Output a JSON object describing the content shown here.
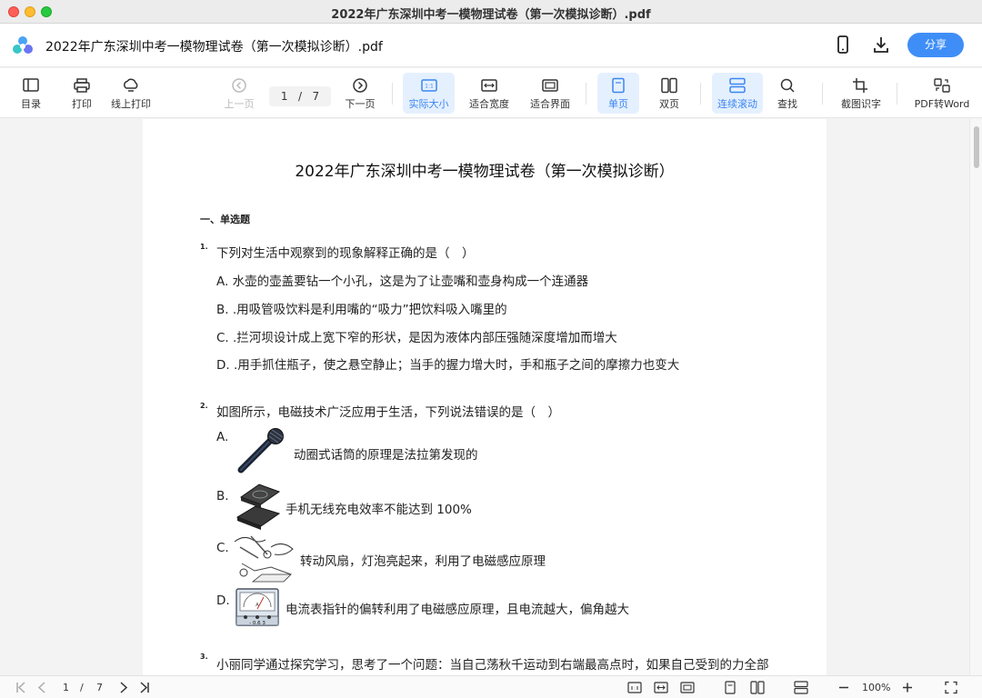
{
  "window": {
    "title": "2022年广东深圳中考一模物理试卷（第一次模拟诊断）.pdf"
  },
  "header": {
    "doc_title": "2022年广东深圳中考一模物理试卷（第一次模拟诊断）.pdf",
    "share_label": "分享"
  },
  "toolbar": {
    "toc": "目录",
    "print": "打印",
    "online_print": "线上打印",
    "prev": "上一页",
    "page_current": "1",
    "page_sep": "/",
    "page_total": "7",
    "next": "下一页",
    "actual_size": "实际大小",
    "fit_width": "适合宽度",
    "fit_screen": "适合界面",
    "single_page": "单页",
    "double_page": "双页",
    "continuous": "连续滚动",
    "find": "查找",
    "ocr": "截图识字",
    "pdf_to_word": "PDF转Word",
    "actual_size_icon_text": "1:1"
  },
  "document": {
    "title": "2022年广东深圳中考一模物理试卷（第一次模拟诊断）",
    "section": "一、单选题",
    "q1": {
      "num": "1.",
      "text": "下列对生活中观察到的现象解释正确的是（　）",
      "a": "A. 水壶的壶盖要钻一个小孔，这是为了让壶嘴和壶身构成一个连通器",
      "b": "B. .用吸管吸饮料是利用嘴的“吸力”把饮料吸入嘴里的",
      "c": "C. .拦河坝设计成上宽下窄的形状，是因为液体内部压强随深度增加而增大",
      "d": "D. .用手抓住瓶子，使之悬空静止；当手的握力增大时，手和瓶子之间的摩擦力也变大"
    },
    "q2": {
      "num": "2.",
      "text": "如图所示，电磁技术广泛应用于生活，下列说法错误的是（　）",
      "a_label": "A.",
      "a": "动圈式话筒的原理是法拉第发现的",
      "b_label": "B.",
      "b": "手机无线充电效率不能达到 100%",
      "c_label": "C.",
      "c": "转动风扇，灯泡亮起来，利用了电磁感应原理",
      "d_label": "D.",
      "d": "电流表指针的偏转利用了电磁感应原理，且电流越大，偏角越大",
      "meter_scale": "- 0.6 3"
    },
    "q3": {
      "num": "3.",
      "text": "小丽同学通过探究学习，思考了一个问题：当自己荡秋千运动到右端最高点时，如果自己受到的力全部"
    }
  },
  "bottombar": {
    "page_current": "1",
    "page_sep": "/",
    "page_total": "7",
    "zoom": "100%"
  },
  "colors": {
    "accent": "#3f8ef7",
    "active_bg": "#e5f0ff",
    "active_text": "#3a86f0"
  }
}
